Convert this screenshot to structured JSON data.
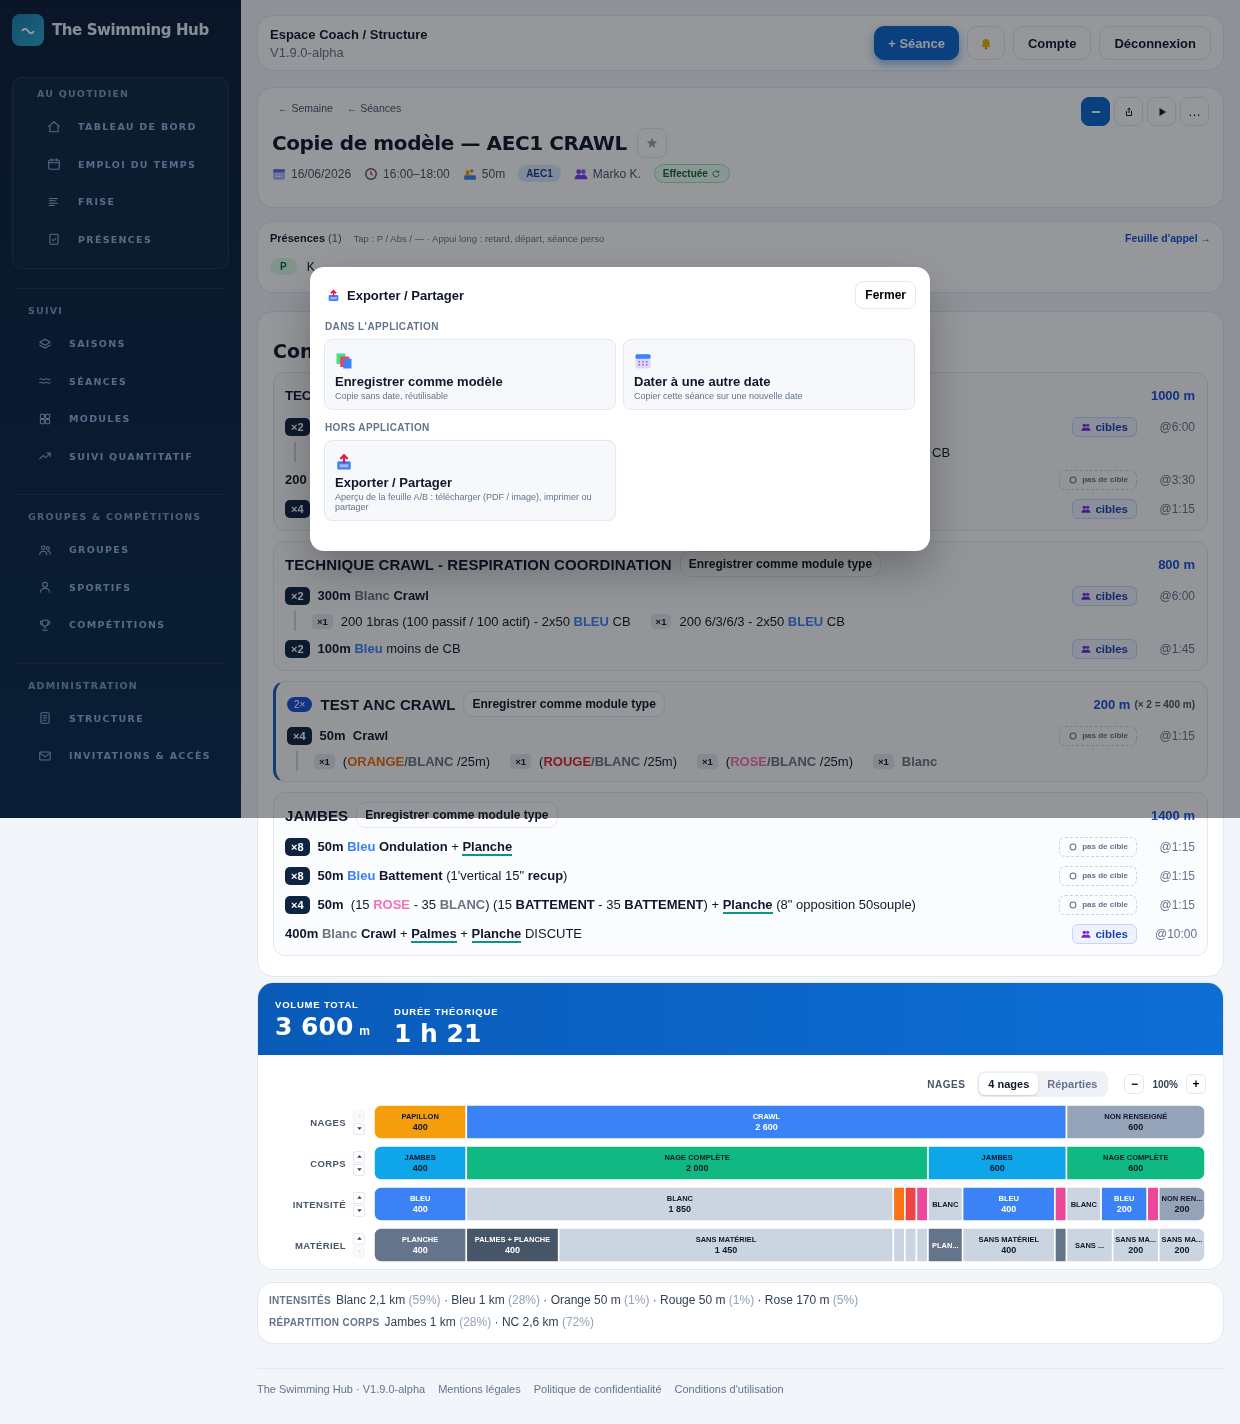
{
  "sidebar": {
    "brand": "The Swimming Hub",
    "sections": [
      {
        "title": "AU QUOTIDIEN",
        "boxed": true,
        "items": [
          {
            "label": "TABLEAU DE BORD"
          },
          {
            "label": "EMPLOI DU TEMPS"
          },
          {
            "label": "FRISE"
          },
          {
            "label": "PRÉSENCES"
          }
        ]
      },
      {
        "title": "SUIVI",
        "boxed": false,
        "items": [
          {
            "label": "SAISONS"
          },
          {
            "label": "SÉANCES"
          },
          {
            "label": "MODULES"
          },
          {
            "label": "SUIVI QUANTITATIF"
          }
        ]
      },
      {
        "title": "GROUPES & COMPÉTITIONS",
        "boxed": false,
        "items": [
          {
            "label": "GROUPES"
          },
          {
            "label": "SPORTIFS"
          },
          {
            "label": "COMPÉTITIONS"
          }
        ]
      },
      {
        "title": "ADMINISTRATION",
        "boxed": false,
        "items": [
          {
            "label": "STRUCTURE"
          },
          {
            "label": "INVITATIONS & ACCÈS"
          }
        ]
      }
    ]
  },
  "topbar": {
    "title": "Espace Coach / Structure",
    "version": "V1.9.0-alpha",
    "buttons": [
      {
        "kind": "primary",
        "label": "+ Séance"
      },
      {
        "kind": "bell"
      },
      {
        "kind": "plain",
        "label": "Compte"
      },
      {
        "kind": "plain",
        "label": "Déconnexion"
      }
    ]
  },
  "session": {
    "breadcrumbs": [
      "← Semaine",
      "← Séances"
    ],
    "tools": [
      {
        "kind": "bar",
        "selected": true
      },
      {
        "kind": "share",
        "selected": false
      },
      {
        "kind": "play",
        "selected": false
      },
      {
        "kind": "more",
        "label": "…",
        "selected": false
      }
    ],
    "title": "Copie de modèle — AEC1 CRAWL",
    "meta": [
      {
        "kind": "date",
        "text": "16/06/2026"
      },
      {
        "kind": "time",
        "text": "16:00–18:00"
      },
      {
        "kind": "pool",
        "text": "50m"
      },
      {
        "kind": "group",
        "text": "AEC1"
      },
      {
        "kind": "coach",
        "text": "Marko K."
      },
      {
        "kind": "status",
        "text": "Effectuée"
      }
    ]
  },
  "presences": {
    "title": "Présences",
    "count": "(1)",
    "hint": "Tap : P / Abs / — · Appui long : retard, départ, séance perso",
    "link": "Feuille d'appel →",
    "athletes": [
      {
        "status": "P",
        "name": "K"
      }
    ]
  },
  "content": {
    "title": "Con",
    "modules": [
      {
        "kind": "partial",
        "title": "TEC",
        "total": "1000 m",
        "rows": [
          {
            "kind": "set",
            "reps": "×2",
            "parts": [],
            "target": {
              "kind": "cibles",
              "label": "cibles"
            },
            "time": "@6:00"
          },
          {
            "kind": "sub",
            "items": [
              {
                "parts": [
                  {
                    "kind": "plain",
                    "text": "CB"
                  }
                ]
              }
            ]
          },
          {
            "kind": "free",
            "parts": [
              {
                "kind": "bold",
                "text": "200"
              }
            ],
            "target": {
              "kind": "none",
              "label": "pas de cible"
            },
            "time": "@3:30"
          },
          {
            "kind": "set",
            "reps": "×4",
            "parts": [],
            "target": {
              "kind": "cibles",
              "label": "cibles"
            },
            "time": "@1:15"
          }
        ]
      },
      {
        "kind": "full",
        "title": "TECHNIQUE CRAWL - RESPIRATION COORDINATION",
        "save": "Enregistrer comme module type",
        "total": "800 m",
        "rows": [
          {
            "kind": "set",
            "reps": "×2",
            "parts": [
              {
                "kind": "bold",
                "text": "300m "
              },
              {
                "kind": "blanc",
                "text": "Blanc"
              },
              {
                "kind": "bold",
                "text": " Crawl"
              }
            ],
            "target": {
              "kind": "cibles",
              "label": "cibles"
            },
            "time": "@6:00"
          },
          {
            "kind": "sub",
            "items": [
              {
                "reps": "×1",
                "parts": [
                  {
                    "kind": "plain",
                    "text": "200 1bras (100 passif / 100 actif) - 2x50 "
                  },
                  {
                    "kind": "bleu",
                    "text": "BLEU"
                  },
                  {
                    "kind": "plain",
                    "text": " CB"
                  }
                ]
              },
              {
                "reps": "×1",
                "parts": [
                  {
                    "kind": "plain",
                    "text": "200 6/3/6/3 - 2x50 "
                  },
                  {
                    "kind": "bleu",
                    "text": "BLEU"
                  },
                  {
                    "kind": "plain",
                    "text": " CB"
                  }
                ]
              }
            ]
          },
          {
            "kind": "set",
            "reps": "×2",
            "parts": [
              {
                "kind": "bold",
                "text": "100m "
              },
              {
                "kind": "bleu",
                "text": "Bleu"
              },
              {
                "kind": "plain",
                "text": " moins de CB"
              }
            ],
            "target": {
              "kind": "cibles",
              "label": "cibles"
            },
            "time": "@1:45"
          }
        ]
      },
      {
        "kind": "full",
        "repeat": "2×",
        "title": "TEST ANC CRAWL",
        "save": "Enregistrer comme module type",
        "total": "200 m",
        "total_note": "(× 2 = 400 m)",
        "rows": [
          {
            "kind": "set",
            "reps": "×4",
            "parts": [
              {
                "kind": "bold",
                "text": "50m  Crawl"
              }
            ],
            "target": {
              "kind": "none",
              "label": "pas de cible"
            },
            "time": "@1:15"
          },
          {
            "kind": "sub",
            "items": [
              {
                "reps": "×1",
                "parts": [
                  {
                    "kind": "plain",
                    "text": "("
                  },
                  {
                    "kind": "orange",
                    "text": "ORANGE"
                  },
                  {
                    "kind": "blanc",
                    "text": "/BLANC"
                  },
                  {
                    "kind": "plain",
                    "text": " /25m)"
                  }
                ]
              },
              {
                "reps": "×1",
                "parts": [
                  {
                    "kind": "plain",
                    "text": "("
                  },
                  {
                    "kind": "rouge",
                    "text": "ROUGE"
                  },
                  {
                    "kind": "blanc",
                    "text": "/BLANC"
                  },
                  {
                    "kind": "plain",
                    "text": " /25m)"
                  }
                ]
              },
              {
                "reps": "×1",
                "parts": [
                  {
                    "kind": "plain",
                    "text": "("
                  },
                  {
                    "kind": "rose",
                    "text": "ROSE"
                  },
                  {
                    "kind": "blanc",
                    "text": "/BLANC"
                  },
                  {
                    "kind": "plain",
                    "text": " /25m)"
                  }
                ]
              },
              {
                "reps": "×1",
                "parts": [
                  {
                    "kind": "blanc",
                    "text": "Blanc"
                  }
                ]
              }
            ]
          }
        ]
      },
      {
        "kind": "full",
        "title": "JAMBES",
        "save": "Enregistrer comme module type",
        "total": "1400 m",
        "rows": [
          {
            "kind": "set",
            "reps": "×8",
            "parts": [
              {
                "kind": "bold",
                "text": "50m "
              },
              {
                "kind": "bleu",
                "text": "Bleu"
              },
              {
                "kind": "bold",
                "text": " Ondulation"
              },
              {
                "kind": "plain",
                "text": " + "
              },
              {
                "kind": "gear",
                "text": "Planche"
              }
            ],
            "target": {
              "kind": "none",
              "label": "pas de cible"
            },
            "time": "@1:15"
          },
          {
            "kind": "set",
            "reps": "×8",
            "parts": [
              {
                "kind": "bold",
                "text": "50m "
              },
              {
                "kind": "bleu",
                "text": "Bleu"
              },
              {
                "kind": "bold",
                "text": " Battement"
              },
              {
                "kind": "plain",
                "text": " (1'vertical 15\" "
              },
              {
                "kind": "bold",
                "text": "recup"
              },
              {
                "kind": "plain",
                "text": ")"
              }
            ],
            "target": {
              "kind": "none",
              "label": "pas de cible"
            },
            "time": "@1:15"
          },
          {
            "kind": "set",
            "reps": "×4",
            "parts": [
              {
                "kind": "bold",
                "text": "50m "
              },
              {
                "kind": "plain",
                "text": " (15 "
              },
              {
                "kind": "rose",
                "text": "ROSE"
              },
              {
                "kind": "plain",
                "text": " - 35 "
              },
              {
                "kind": "blanc",
                "text": "BLANC"
              },
              {
                "kind": "plain",
                "text": ") (15 "
              },
              {
                "kind": "bold",
                "text": "BATTEMENT"
              },
              {
                "kind": "plain",
                "text": " - 35 "
              },
              {
                "kind": "bold",
                "text": "BATTEMENT"
              },
              {
                "kind": "plain",
                "text": ") + "
              },
              {
                "kind": "gear",
                "text": "Planche"
              },
              {
                "kind": "plain",
                "text": " (8\" opposition 50souple)"
              }
            ],
            "target": {
              "kind": "none",
              "label": "pas de cible"
            },
            "time": "@1:15"
          },
          {
            "kind": "free",
            "parts": [
              {
                "kind": "bold",
                "text": "400m "
              },
              {
                "kind": "blanc",
                "text": "Blanc"
              },
              {
                "kind": "bold",
                "text": " Crawl"
              },
              {
                "kind": "plain",
                "text": " + "
              },
              {
                "kind": "gear",
                "text": "Palmes"
              },
              {
                "kind": "plain",
                "text": " + "
              },
              {
                "kind": "gear",
                "text": "Planche"
              },
              {
                "kind": "plain",
                "text": " DISCUTE"
              }
            ],
            "target": {
              "kind": "cibles",
              "label": "cibles"
            },
            "time": "@10:00"
          }
        ]
      }
    ]
  },
  "totals": {
    "volume": {
      "label": "VOLUME TOTAL",
      "value": "3 600",
      "unit": "m"
    },
    "duration": {
      "label": "DURÉE THÉORIQUE",
      "value": "1 h 21"
    }
  },
  "chart": {
    "mode_label": "NAGES",
    "modes": [
      {
        "label": "4 nages",
        "selected": true
      },
      {
        "label": "Réparties",
        "selected": false
      }
    ],
    "zoom": {
      "minus": "−",
      "value": "100%",
      "plus": "+"
    },
    "row_controls": [
      {
        "up_disabled": true,
        "down_disabled": false
      },
      {
        "up_disabled": false,
        "down_disabled": false
      },
      {
        "up_disabled": false,
        "down_disabled": false
      },
      {
        "up_disabled": false,
        "down_disabled": true
      }
    ],
    "chart_data": {
      "type": "bar",
      "orientation": "horizontal",
      "stacked": true,
      "categories": [
        "NAGES",
        "CORPS",
        "INTENSITÉ",
        "MATÉRIEL"
      ],
      "series": [
        {
          "name": "PAPILLON",
          "color": "#f59e0b",
          "values": [
            400,
            null,
            null,
            null
          ],
          "value_labels": [
            "400",
            null,
            null,
            null
          ]
        },
        {
          "name": "CRAWL",
          "color": "#3b82f6",
          "values": [
            2600,
            null,
            null,
            null
          ],
          "value_labels": [
            "2 600",
            null,
            null,
            null
          ]
        },
        {
          "name": "NON RENSEIGNÉ",
          "color": "#94a3b8",
          "values": [
            600,
            null,
            null,
            null
          ],
          "value_labels": [
            "600",
            null,
            null,
            null
          ]
        },
        {
          "name": "JAMBES",
          "color": "#0ea5e9",
          "values": [
            null,
            400,
            null,
            null
          ],
          "value_labels": [
            null,
            "400",
            null,
            null
          ]
        },
        {
          "name": "NAGE COMPLÈTE",
          "color": "#10b981",
          "values": [
            null,
            2000,
            null,
            null
          ],
          "value_labels": [
            null,
            "2 000",
            null,
            null
          ]
        },
        {
          "name": "JAMBES",
          "color": "#0ea5e9",
          "values": [
            null,
            600,
            null,
            null
          ],
          "value_labels": [
            null,
            "600",
            null,
            null
          ]
        },
        {
          "name": "NAGE COMPLÈTE",
          "color": "#10b981",
          "values": [
            null,
            600,
            null,
            null
          ],
          "value_labels": [
            null,
            "600",
            null,
            null
          ]
        },
        {
          "name": "BLEU",
          "color": "#3b82f6",
          "values": [
            null,
            null,
            400,
            null
          ],
          "value_labels": [
            null,
            null,
            "400",
            null
          ]
        },
        {
          "name": "BLANC",
          "color": "#cbd5e1",
          "values": [
            null,
            null,
            1850,
            null
          ],
          "value_labels": [
            null,
            null,
            "1 850",
            null
          ]
        },
        {
          "color": "#f97316",
          "values": [
            null,
            null,
            50,
            null
          ]
        },
        {
          "color": "#ef4444",
          "values": [
            null,
            null,
            50,
            null
          ]
        },
        {
          "color": "#ec4899",
          "values": [
            null,
            null,
            50,
            null
          ]
        },
        {
          "name": "BLANC",
          "color": "#cbd5e1",
          "values": [
            null,
            null,
            150,
            null
          ]
        },
        {
          "name": "BLEU",
          "color": "#3b82f6",
          "values": [
            null,
            null,
            400,
            null
          ],
          "value_labels": [
            null,
            null,
            "400",
            null
          ]
        },
        {
          "color": "#ec4899",
          "values": [
            null,
            null,
            50,
            null
          ]
        },
        {
          "name": "BLANC",
          "color": "#cbd5e1",
          "values": [
            null,
            null,
            150,
            null
          ]
        },
        {
          "name": "BLEU",
          "color": "#3b82f6",
          "values": [
            null,
            null,
            200,
            null
          ],
          "value_labels": [
            null,
            null,
            "200",
            null
          ]
        },
        {
          "color": "#ec4899",
          "values": [
            null,
            null,
            50,
            null
          ]
        },
        {
          "name": "NON REN...",
          "color": "#94a3b8",
          "values": [
            null,
            null,
            200,
            null
          ],
          "value_labels": [
            null,
            null,
            "200",
            null
          ]
        },
        {
          "name": "PLANCHE",
          "color": "#64748b",
          "values": [
            null,
            null,
            null,
            400
          ],
          "value_labels": [
            null,
            null,
            null,
            "400"
          ]
        },
        {
          "name": "PALMES + PLANCHE",
          "color": "#475569",
          "values": [
            null,
            null,
            null,
            400
          ],
          "value_labels": [
            null,
            null,
            null,
            "400"
          ]
        },
        {
          "name": "SANS MATÉRIEL",
          "color": "#cbd5e1",
          "values": [
            null,
            null,
            null,
            1450
          ],
          "value_labels": [
            null,
            null,
            null,
            "1 450"
          ]
        },
        {
          "color": "#cbd5e1",
          "values": [
            null,
            null,
            null,
            50
          ]
        },
        {
          "color": "#cbd5e1",
          "values": [
            null,
            null,
            null,
            50
          ]
        },
        {
          "color": "#cbd5e1",
          "values": [
            null,
            null,
            null,
            50
          ]
        },
        {
          "name": "PLAN...",
          "color": "#64748b",
          "values": [
            null,
            null,
            null,
            150
          ]
        },
        {
          "name": "SANS MATÉRIEL",
          "color": "#cbd5e1",
          "values": [
            null,
            null,
            null,
            400
          ],
          "value_labels": [
            null,
            null,
            null,
            "400"
          ]
        },
        {
          "color": "#64748b",
          "values": [
            null,
            null,
            null,
            50
          ]
        },
        {
          "name": "SANS ...",
          "color": "#cbd5e1",
          "values": [
            null,
            null,
            null,
            200
          ]
        },
        {
          "name": "SANS MA...",
          "color": "#cbd5e1",
          "values": [
            null,
            null,
            null,
            200
          ],
          "value_labels": [
            null,
            null,
            null,
            "200"
          ]
        },
        {
          "name": "SANS MA...",
          "color": "#cbd5e1",
          "values": [
            null,
            null,
            null,
            200
          ],
          "value_labels": [
            null,
            null,
            null,
            "200"
          ]
        }
      ]
    }
  },
  "summary": [
    {
      "label": "INTENSITÉS",
      "separator": "·",
      "items": [
        {
          "text": "Blanc 2,1 km",
          "share": "(59%)"
        },
        {
          "text": "Bleu 1 km",
          "share": "(28%)"
        },
        {
          "text": "Orange 50 m",
          "share": "(1%)"
        },
        {
          "text": "Rouge 50 m",
          "share": "(1%)"
        },
        {
          "text": "Rose 170 m",
          "share": "(5%)"
        }
      ]
    },
    {
      "label": "RÉPARTITION CORPS",
      "separator": "·",
      "items": [
        {
          "text": "Jambes 1 km",
          "share": "(28%)"
        },
        {
          "text": "NC 2,6 km",
          "share": "(72%)"
        }
      ]
    }
  ],
  "footer": {
    "text": "The Swimming Hub · V1.9.0-alpha",
    "links": [
      "Mentions légales",
      "Politique de confidentialité",
      "Conditions d'utilisation"
    ]
  },
  "modal": {
    "title": "Exporter / Partager",
    "close": "Fermer",
    "sections": [
      {
        "title": "DANS L'APPLICATION",
        "options": [
          {
            "title": "Enregistrer comme modèle",
            "desc": "Copie sans date, réutilisable"
          },
          {
            "title": "Dater à une autre date",
            "desc": "Copier cette séance sur une nouvelle date"
          }
        ]
      },
      {
        "title": "HORS APPLICATION",
        "options": [
          {
            "title": "Exporter / Partager",
            "desc": "Aperçu de la feuille A/B : télécharger (PDF / image), imprimer ou partager"
          }
        ]
      }
    ]
  }
}
